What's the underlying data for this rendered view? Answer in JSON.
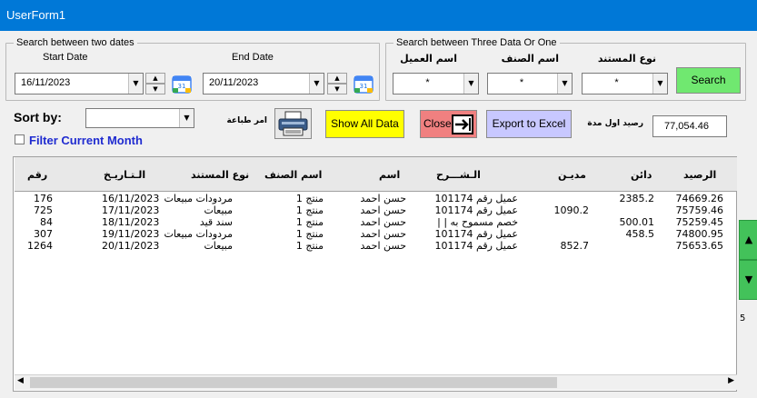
{
  "window": {
    "title": "UserForm1"
  },
  "date_group": {
    "legend": "Search between two dates",
    "start_label": "Start Date",
    "end_label": "End Date",
    "start_value": "16/11/2023",
    "end_value": "20/11/2023"
  },
  "data_group": {
    "legend": "Search between Three Data Or One",
    "customer_label": "اسم العميل",
    "item_label": "اسم الصنف",
    "doc_type_label": "نوع المستند",
    "customer_value": "*",
    "item_value": "*",
    "doc_type_value": "*",
    "search_label": "Search"
  },
  "toolbar": {
    "sort_label": "Sort by:",
    "sort_value": "",
    "print_label": "امر طباعة",
    "show_all_label": "Show All Data",
    "close_label": "Close",
    "export_label": "Export to Excel",
    "opening_balance_label": "رصيد اول مدة",
    "opening_balance_value": "77,054.46",
    "filter_label": "Filter Current Month"
  },
  "grid": {
    "headers": {
      "balance": "الرصيد",
      "credit": "دائن",
      "debit": "مديـن",
      "description": "الـشـــرح",
      "name": "اسم",
      "item": "اسم الصنف",
      "doc_type": "نوع المستند",
      "date": "الـتـاريـخ",
      "number": "رقم"
    },
    "rows": [
      {
        "balance": "74669.26",
        "credit": "2385.2",
        "debit": "",
        "description": "عميل رقم 101174",
        "name": "حسن احمد",
        "item": "منتج 1",
        "doc_type": "مردودات مبيعات",
        "date": "16/11/2023",
        "number": "176"
      },
      {
        "balance": "75759.46",
        "credit": "",
        "debit": "1090.2",
        "description": "عميل رقم 101174",
        "name": "حسن احمد",
        "item": "منتج 1",
        "doc_type": "مبيعات",
        "date": "17/11/2023",
        "number": "725"
      },
      {
        "balance": "75259.45",
        "credit": "500.01",
        "debit": "",
        "description": "خصم مسموح به | |",
        "name": "حسن احمد",
        "item": "منتج 1",
        "doc_type": "سند قيد",
        "date": "18/11/2023",
        "number": "84"
      },
      {
        "balance": "74800.95",
        "credit": "458.5",
        "debit": "",
        "description": "عميل رقم 101174",
        "name": "حسن احمد",
        "item": "منتج 1",
        "doc_type": "مردودات مبيعات",
        "date": "19/11/2023",
        "number": "307"
      },
      {
        "balance": "75653.65",
        "credit": "",
        "debit": "852.7",
        "description": "عميل رقم 101174",
        "name": "حسن احمد",
        "item": "منتج 1",
        "doc_type": "مبيعات",
        "date": "20/11/2023",
        "number": "1264"
      }
    ]
  },
  "side": {
    "fragment": "5"
  },
  "colors": {
    "titlebar": "#0078d7",
    "search": "#70e870",
    "show_all": "#ffff00",
    "close": "#f08080",
    "export": "#c8c8ff",
    "scroll_green": "#43c25a"
  }
}
